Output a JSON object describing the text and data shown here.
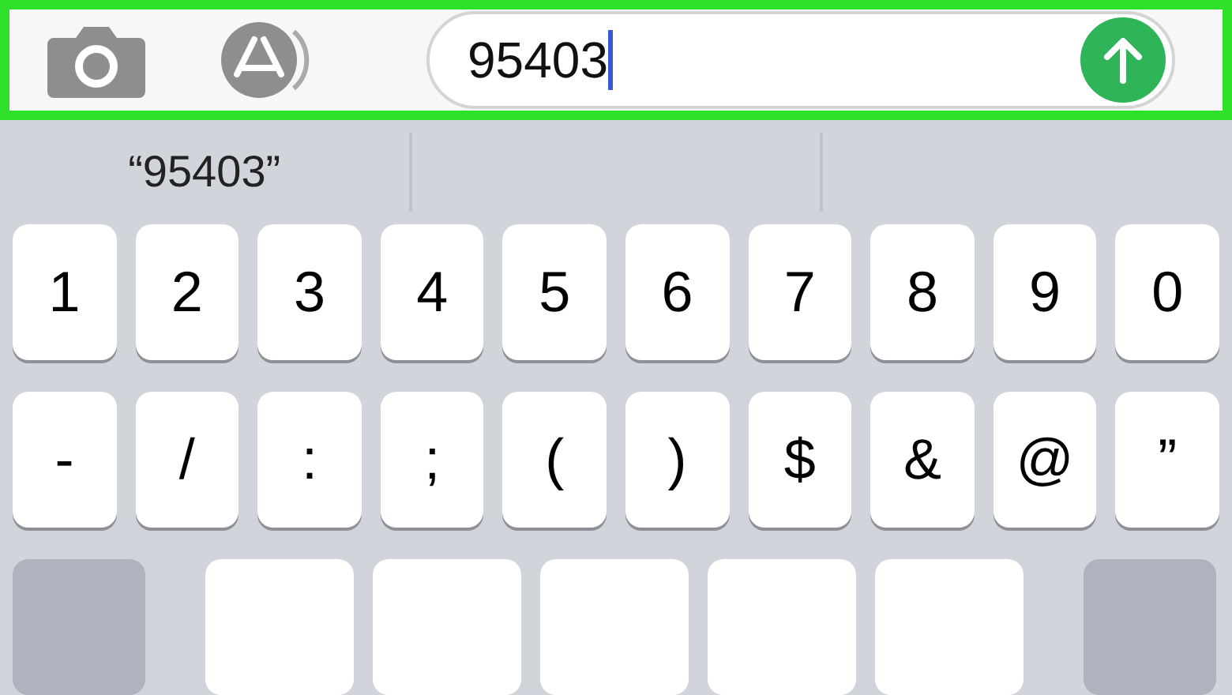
{
  "message_bar": {
    "highlighted": true,
    "input": {
      "value": "95403"
    }
  },
  "suggestions": [
    "“95403”"
  ],
  "key_rows": [
    [
      "1",
      "2",
      "3",
      "4",
      "5",
      "6",
      "7",
      "8",
      "9",
      "0"
    ],
    [
      "-",
      "/",
      ":",
      ";",
      "(",
      ")",
      "$",
      "&",
      "@",
      "”"
    ]
  ],
  "bottom_row": [
    {
      "kind": "modifier"
    },
    {
      "kind": "key"
    },
    {
      "kind": "key"
    },
    {
      "kind": "key"
    },
    {
      "kind": "key"
    },
    {
      "kind": "key"
    },
    {
      "kind": "modifier"
    }
  ]
}
